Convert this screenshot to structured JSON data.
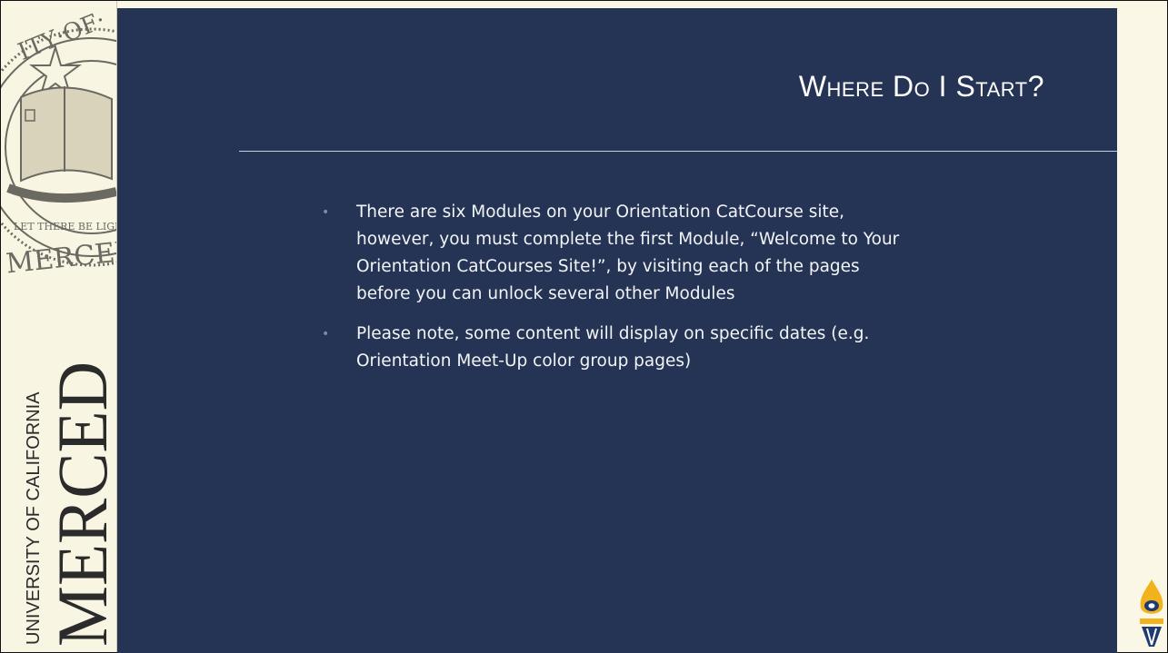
{
  "slide": {
    "title": "Where Do I Start?",
    "bullets": [
      "There are six Modules on your Orientation CatCourse site, however, you must complete the first Module, “Welcome to Your Orientation CatCourses Site!”, by visiting each of the pages before you can unlock several other Modules",
      "Please note, some content will display on specific dates (e.g. Orientation Meet-Up color group pages)"
    ]
  },
  "branding": {
    "seal_text_top": "ITY·OF·",
    "seal_text_bottom": "MERCED",
    "seal_ribbon": "LET THERE BE LIGHT",
    "wordmark_small": "UNIVERSITY OF CALIFORNIA",
    "wordmark_large": "MERCED"
  },
  "colors": {
    "slide_background": "#253455",
    "sidebar_background": "#f9f5e3",
    "seal_ink": "#6a6a62",
    "torch_gold": "#f2b21b",
    "torch_blue": "#1f3a70"
  }
}
